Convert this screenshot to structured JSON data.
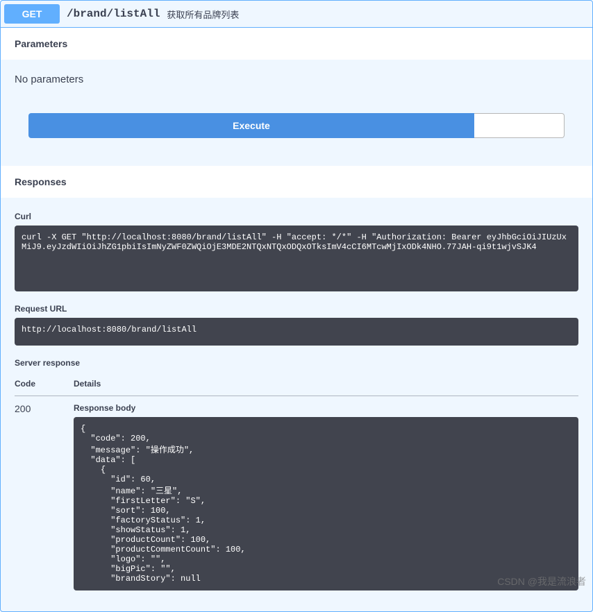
{
  "summary": {
    "method": "GET",
    "path": "/brand/listAll",
    "description": "获取所有品牌列表"
  },
  "sections": {
    "parameters_title": "Parameters",
    "no_parameters": "No parameters",
    "responses_title": "Responses"
  },
  "buttons": {
    "execute": "Execute",
    "clear": ""
  },
  "curl": {
    "label": "Curl",
    "command": "curl -X GET \"http://localhost:8080/brand/listAll\" -H \"accept: */*\" -H \"Authorization: Bearer eyJhbGciOiJIUzUxMiJ9.eyJzdWIiOiJhZG1pbiIsImNyZWF0ZWQiOjE3MDE2NTQxNTQxODQxOTksImV4cCI6MTcwMjIxODk4NHO.77JAH-qi9t1wjvSJK4"
  },
  "request_url": {
    "label": "Request URL",
    "value": "http://localhost:8080/brand/listAll"
  },
  "server_response": {
    "label": "Server response",
    "columns": {
      "code": "Code",
      "details": "Details"
    },
    "code": "200",
    "body_label": "Response body",
    "body": "{\n  \"code\": 200,\n  \"message\": \"操作成功\",\n  \"data\": [\n    {\n      \"id\": 60,\n      \"name\": \"三星\",\n      \"firstLetter\": \"S\",\n      \"sort\": 100,\n      \"factoryStatus\": 1,\n      \"showStatus\": 1,\n      \"productCount\": 100,\n      \"productCommentCount\": 100,\n      \"logo\": \"\",\n      \"bigPic\": \"\",\n      \"brandStory\": null"
  },
  "watermark": "CSDN @我是流浪者"
}
